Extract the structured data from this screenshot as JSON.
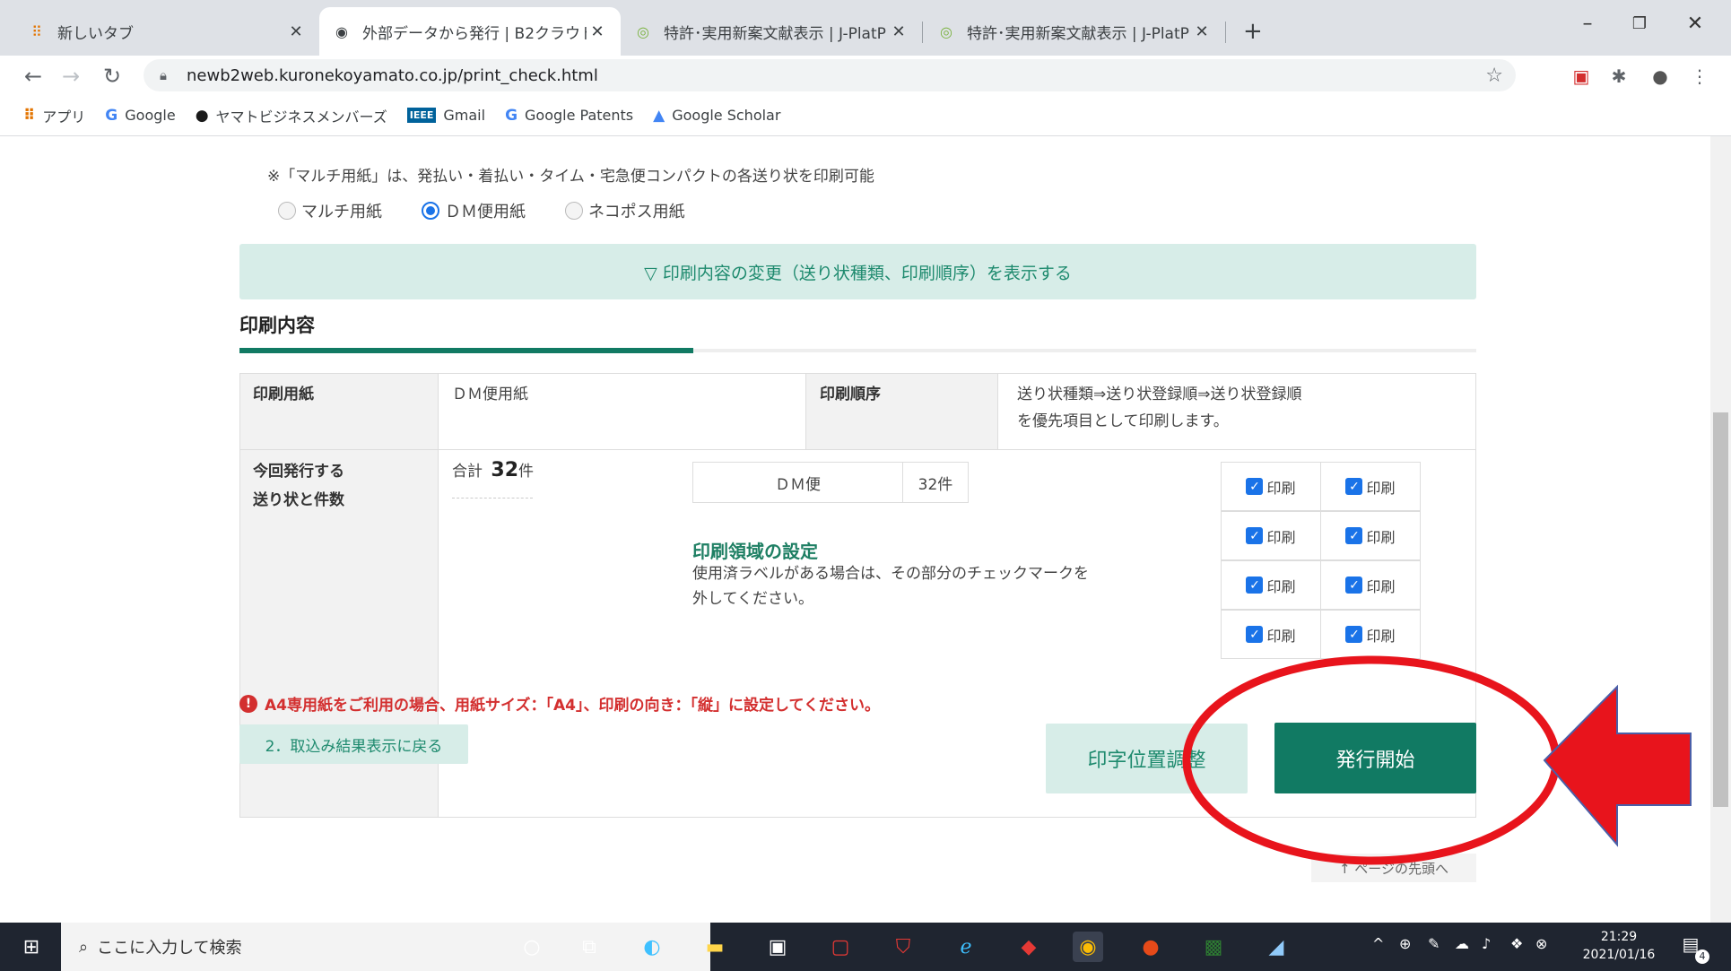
{
  "browser": {
    "tabs": [
      {
        "title": "新しいタブ",
        "active": false
      },
      {
        "title": "外部データから発行 | B2クラウド",
        "active": true
      },
      {
        "title": "特許･実用新案文献表示 | J-PlatP",
        "active": false
      },
      {
        "title": "特許･実用新案文献表示 | J-PlatP",
        "active": false
      }
    ],
    "new_tab_label": "+",
    "url": "newb2web.kuronekoyamato.co.jp/print_check.html",
    "bookmarks": [
      {
        "label": "アプリ",
        "icon": "apps-grid-icon"
      },
      {
        "label": "Google",
        "icon": "google-icon"
      },
      {
        "label": "ヤマトビジネスメンバーズ",
        "icon": "yamato-icon"
      },
      {
        "label": "Gmail",
        "icon": "ieee-icon"
      },
      {
        "label": "Google Patents",
        "icon": "google-icon"
      },
      {
        "label": "Google Scholar",
        "icon": "scholar-icon"
      }
    ]
  },
  "page": {
    "paper_note": "※「マルチ用紙」は、発払い・着払い・タイム・宅急便コンパクトの各送り状を印刷可能",
    "paper_options": [
      {
        "label": "マルチ用紙",
        "selected": false
      },
      {
        "label": "ＤＭ便用紙",
        "selected": true
      },
      {
        "label": "ネコポス用紙",
        "selected": false
      }
    ],
    "toggle_label": "▽ 印刷内容の変更（送り状種類、印刷順序）を表示する",
    "section_title": "印刷内容",
    "table": {
      "paper_header": "印刷用紙",
      "paper_value": "ＤＭ便用紙",
      "order_header": "印刷順序",
      "order_value_line1": "送り状種類⇒送り状登録順⇒送り状登録順",
      "order_value_line2": "を優先項目として印刷します。",
      "count_header_line1": "今回発行する",
      "count_header_line2": "送り状と件数",
      "total_prefix": "合計",
      "total_count": "32",
      "total_suffix": "件",
      "item_type": "ＤＭ便",
      "item_count": "32件",
      "print_area_title": "印刷領域の設定",
      "print_area_desc_line1": "使用済ラベルがある場合は、その部分のチェックマークを",
      "print_area_desc_line2": "外してください。",
      "checkbox_label": "印刷",
      "checkboxes_checked": [
        true,
        true,
        true,
        true,
        true,
        true,
        true,
        true
      ]
    },
    "warning": "A4専用紙をご利用の場合、用紙サイズ：「A4」、印刷の向き：「縦」に設定してください。",
    "back_button": "2．取込み結果表示に戻る",
    "adjust_button": "印字位置調整",
    "issue_button": "発行開始",
    "page_top_link": "↑ ページの先頭へ"
  },
  "annotation": {
    "color": "#e8141c",
    "shapes": [
      "ellipse-highlight",
      "arrow-left"
    ]
  },
  "taskbar": {
    "search_placeholder": "ここに入力して検索",
    "time": "21:29",
    "date": "2021/01/16",
    "notification_count": "4"
  }
}
